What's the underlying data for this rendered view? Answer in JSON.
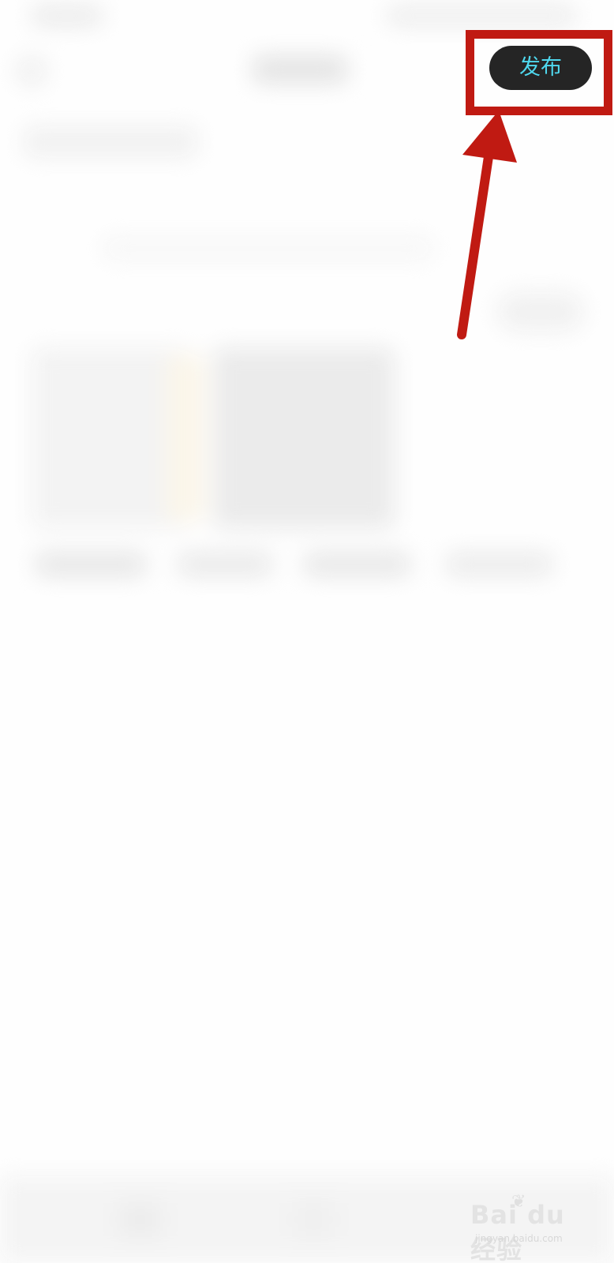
{
  "header": {
    "publish_label": "发布"
  },
  "annotation": {
    "color": "#c01a12"
  },
  "watermark": {
    "brand": "Bai du 经验",
    "site": "jingyan.baidu.com"
  },
  "colors": {
    "button_bg": "#252525",
    "button_text": "#4fd8ee",
    "background": "#ffffff"
  }
}
